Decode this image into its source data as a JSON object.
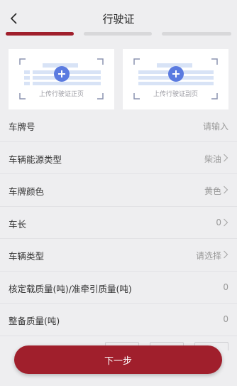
{
  "header": {
    "title": "行驶证",
    "back_icon": "chevron-left-icon"
  },
  "steps": {
    "total": 3,
    "current": 1
  },
  "uploads": [
    {
      "label": "上传行驶证正页",
      "icon": "plus-icon"
    },
    {
      "label": "上传行驶证副页",
      "icon": "plus-icon"
    }
  ],
  "form": {
    "rows": [
      {
        "label": "车牌号",
        "value": "请输入",
        "arrow": false
      },
      {
        "label": "车辆能源类型",
        "value": "柴油",
        "arrow": true
      },
      {
        "label": "车牌颜色",
        "value": "黄色",
        "arrow": true
      },
      {
        "label": "车长",
        "value": "0",
        "arrow": true
      },
      {
        "label": "车辆类型",
        "value": "请选择",
        "arrow": true
      },
      {
        "label": "核定载质量(吨)/准牵引质量(吨)",
        "value": "0",
        "arrow": false
      },
      {
        "label": "整备质量(吨)",
        "value": "0",
        "arrow": false
      }
    ]
  },
  "next_button": {
    "label": "下一步"
  },
  "colors": {
    "brand": "#a01f2c",
    "accent": "#5b7be0",
    "background": "#eeeef0"
  }
}
